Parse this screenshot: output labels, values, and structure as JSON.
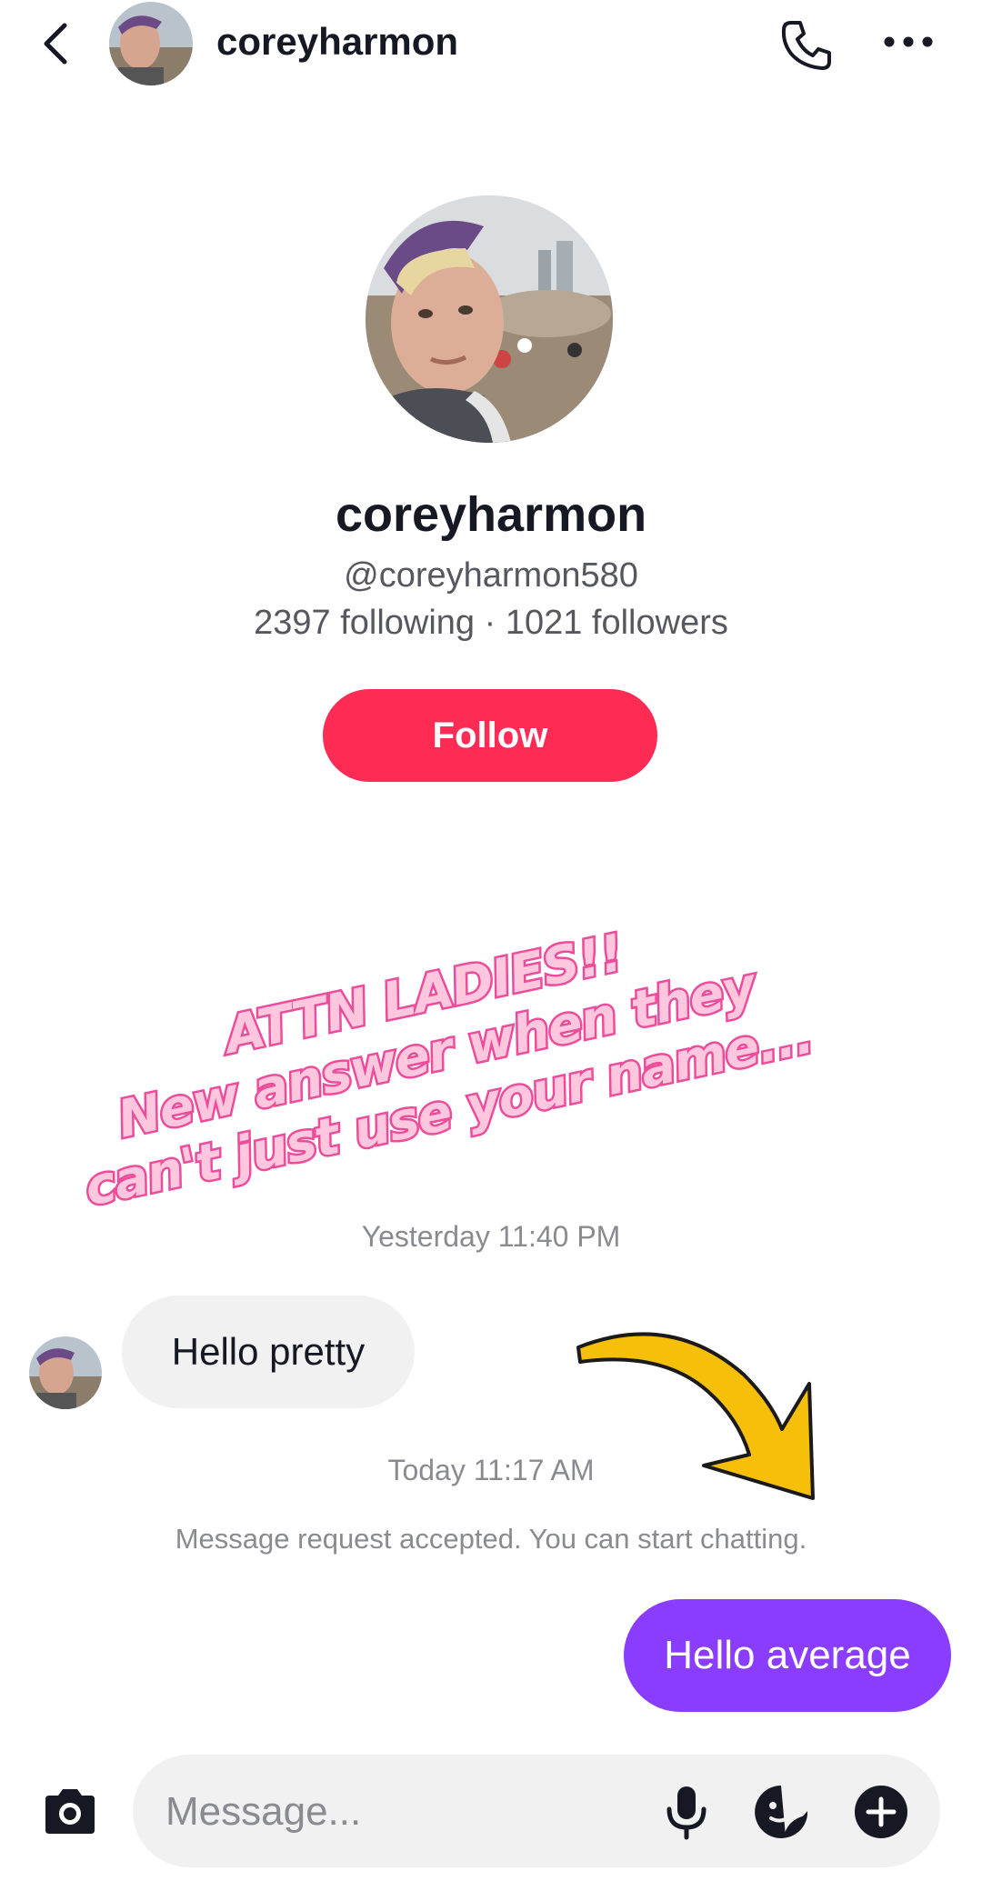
{
  "header": {
    "username": "coreyharmon",
    "icons": [
      "chevron-left-icon",
      "phone-icon",
      "more-icon"
    ]
  },
  "profile": {
    "display_name": "coreyharmon",
    "handle": "@coreyharmon580",
    "stats": "2397 following · 1021 followers",
    "follow_label": "Follow"
  },
  "overlay": {
    "line1": "ATTN LADIES!!",
    "line2": "New answer when they",
    "line3": "can't just use your name...",
    "colors": {
      "fill": "#ffc7de",
      "stroke": "#ec4c9a"
    }
  },
  "chat": {
    "timestamp_1": "Yesterday 11:40 PM",
    "incoming_message": "Hello pretty",
    "timestamp_2": "Today 11:17 AM",
    "system_message": "Message request accepted. You can start chatting.",
    "outgoing_message": "Hello average"
  },
  "input": {
    "placeholder": "Message...",
    "icons": [
      "camera-icon",
      "microphone-icon",
      "sticker-icon",
      "plus-icon"
    ]
  },
  "colors": {
    "follow_button": "#fe2c55",
    "outgoing_bubble": "#8b3dff",
    "incoming_bubble": "#f1f1f2",
    "arrow": "#f5bf0a"
  }
}
